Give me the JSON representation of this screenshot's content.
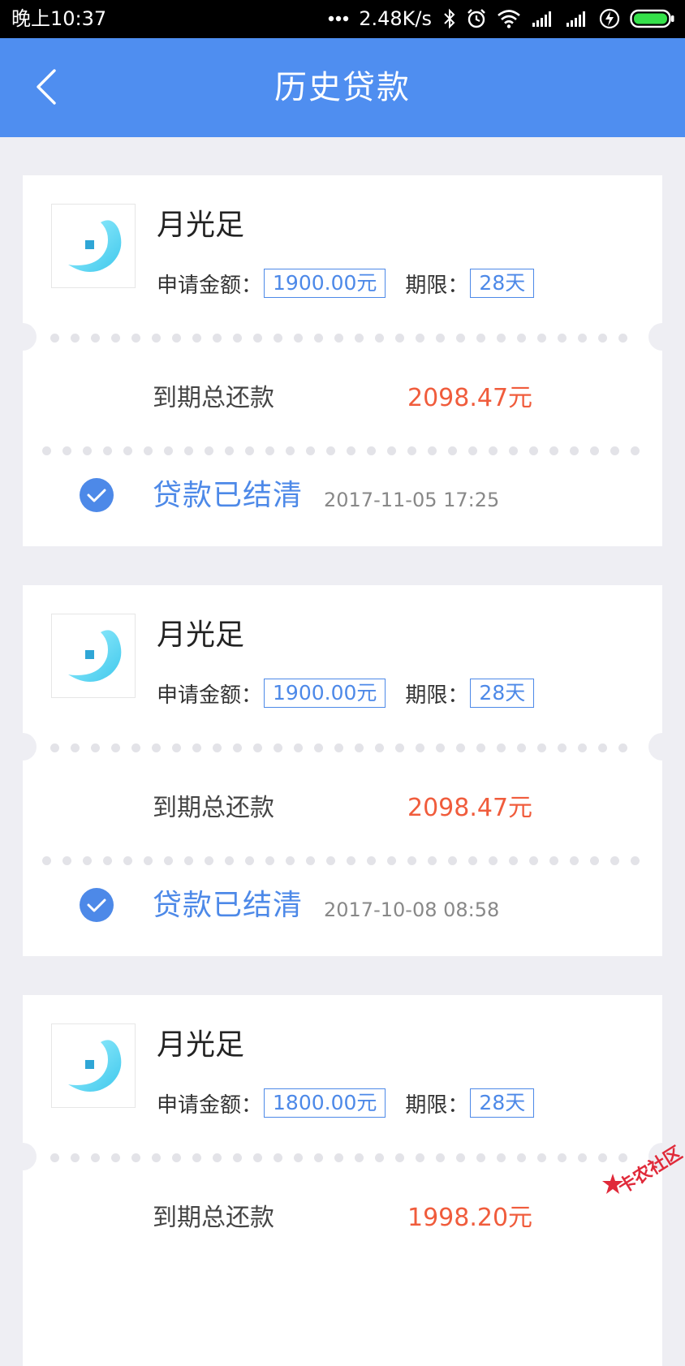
{
  "status_bar": {
    "time": "晚上10:37",
    "speed": "2.48K/s",
    "icons": [
      "more-dots-icon",
      "bluetooth-icon",
      "alarm-icon",
      "wifi-icon",
      "signal-icon",
      "signal-icon-2",
      "charging-icon",
      "battery-icon"
    ]
  },
  "nav": {
    "title": "历史贷款",
    "back_icon": "chevron-left-icon"
  },
  "labels": {
    "apply_amount": "申请金额：",
    "period": "期限：",
    "total_due": "到期总还款"
  },
  "loans": [
    {
      "product": "月光足",
      "amount": "1900.00元",
      "period": "28天",
      "total": "2098.47元",
      "status": "贷款已结清",
      "time": "2017-11-05 17:25"
    },
    {
      "product": "月光足",
      "amount": "1900.00元",
      "period": "28天",
      "total": "2098.47元",
      "status": "贷款已结清",
      "time": "2017-10-08 08:58"
    },
    {
      "product": "月光足",
      "amount": "1800.00元",
      "period": "28天",
      "total": "1998.20元",
      "status": "",
      "time": ""
    }
  ],
  "watermark": "卡农社区",
  "colors": {
    "nav_blue": "#4f8ef0",
    "accent_blue": "#4d89e8",
    "amount_red": "#f05c3c",
    "background": "#eeeef3"
  }
}
